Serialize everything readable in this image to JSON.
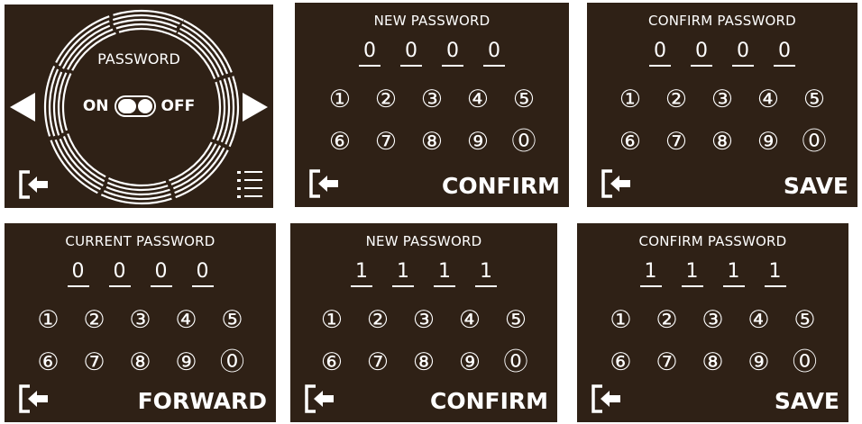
{
  "main": {
    "label": "PASSWORD",
    "toggle_on": "ON",
    "toggle_off": "OFF"
  },
  "keypad": {
    "row1": [
      "①",
      "②",
      "③",
      "④",
      "⑤"
    ],
    "row2": [
      "⑥",
      "⑦",
      "⑧",
      "⑨",
      "⓪"
    ]
  },
  "panels": {
    "new_pw_1": {
      "title": "NEW PASSWORD",
      "digits": [
        "0",
        "0",
        "0",
        "0"
      ],
      "action": "CONFIRM"
    },
    "confirm_pw_1": {
      "title": "CONFIRM PASSWORD",
      "digits": [
        "0",
        "0",
        "0",
        "0"
      ],
      "action": "SAVE"
    },
    "current_pw": {
      "title": "CURRENT PASSWORD",
      "digits": [
        "0",
        "0",
        "0",
        "0"
      ],
      "action": "FORWARD"
    },
    "new_pw_2": {
      "title": "NEW PASSWORD",
      "digits": [
        "1",
        "1",
        "1",
        "1"
      ],
      "action": "CONFIRM"
    },
    "confirm_pw_2": {
      "title": "CONFIRM PASSWORD",
      "digits": [
        "1",
        "1",
        "1",
        "1"
      ],
      "action": "SAVE"
    }
  },
  "icons": {
    "back": "exit-icon",
    "list": "list-icon",
    "left": "left-arrow-icon",
    "right": "right-arrow-icon"
  },
  "colors": {
    "panel_bg": "#2f2116",
    "foreground": "#ffffff"
  }
}
